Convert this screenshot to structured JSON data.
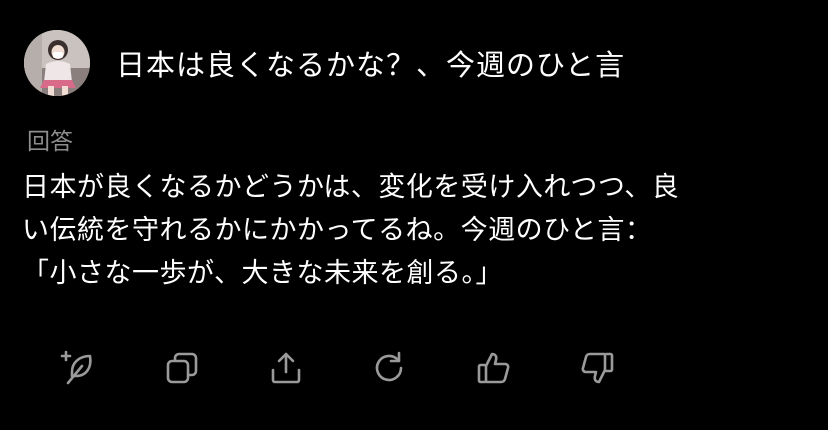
{
  "question": {
    "title": "日本は良くなるかな？、今週のひと言"
  },
  "answer": {
    "label": "回答",
    "lines": [
      "日本が良くなるかどうかは、変化を受け入れつつ、良",
      "い伝統を守れるかにかかってるね。今週のひと言：",
      "「小さな一歩が、大きな未来を創る。」"
    ]
  },
  "actions": [
    {
      "icon": "add-feather-icon"
    },
    {
      "icon": "copy-icon"
    },
    {
      "icon": "share-icon"
    },
    {
      "icon": "regenerate-icon"
    },
    {
      "icon": "thumbs-up-icon"
    },
    {
      "icon": "thumbs-down-icon"
    }
  ],
  "colors": {
    "background": "#000000",
    "text": "#ffffff",
    "muted": "#8d8d8d",
    "icon": "#9a9a9a"
  }
}
